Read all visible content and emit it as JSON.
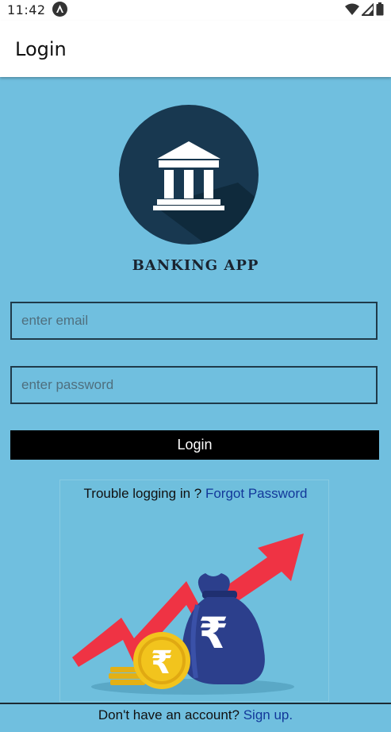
{
  "status_bar": {
    "time": "11:42",
    "icons": [
      "app-notification-icon",
      "wifi-icon",
      "cellular-signal-icon",
      "battery-icon"
    ]
  },
  "app_bar": {
    "title": "Login"
  },
  "logo": {
    "icon": "bank-building-icon",
    "brand_name": "BANKING APP"
  },
  "form": {
    "email": {
      "value": "",
      "placeholder": "enter email"
    },
    "password": {
      "value": "",
      "placeholder": "enter password"
    },
    "login_label": "Login"
  },
  "help": {
    "trouble_text": "Trouble logging in ?",
    "forgot_link": "Forgot Password"
  },
  "illustration": {
    "icon": "rupee-growth-illustration"
  },
  "footer": {
    "prompt": "Don't have an account?",
    "signup_link": "Sign up."
  },
  "colors": {
    "background": "#70bfdf",
    "logo_circle": "#183850",
    "button": "#000000",
    "link": "#12389a",
    "arrow": "#ef3344",
    "money_bag": "#2c3f8c",
    "coin": "#f2c41d"
  }
}
